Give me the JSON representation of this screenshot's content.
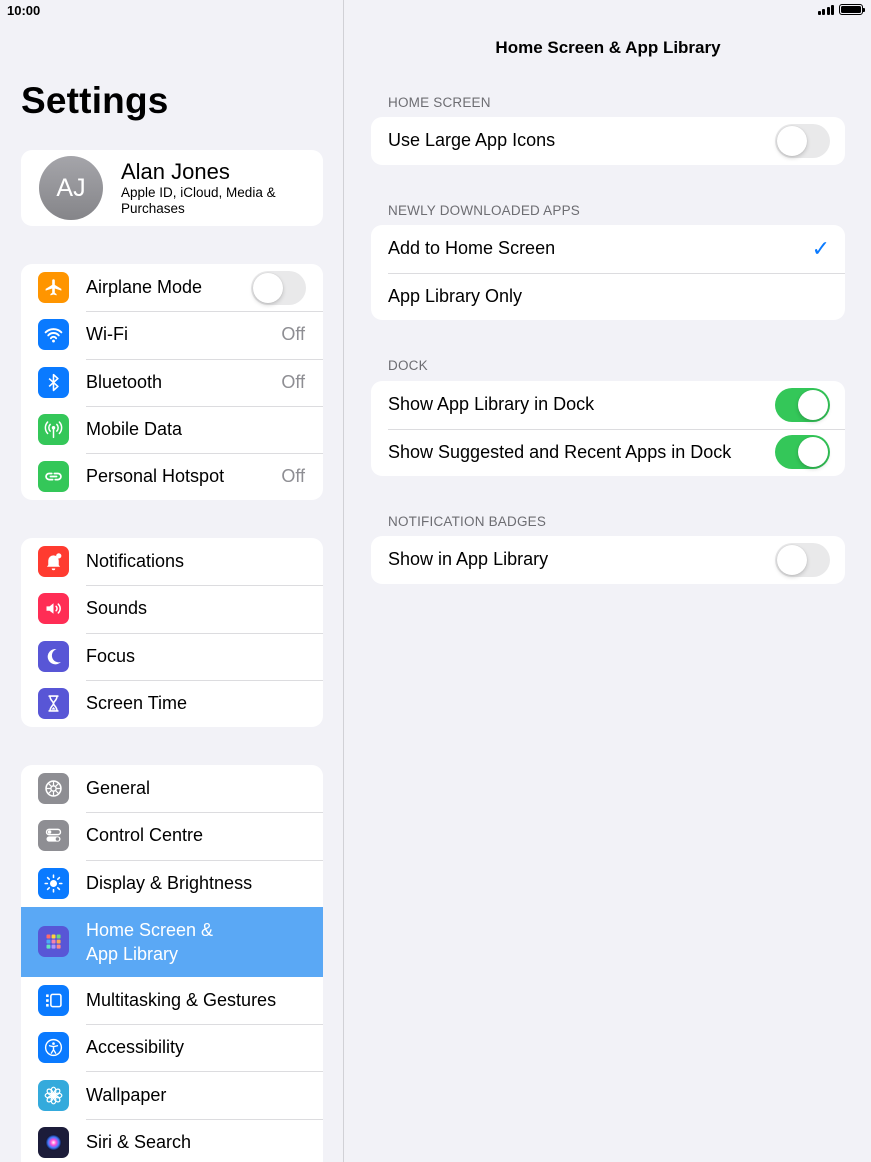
{
  "status": {
    "time": "10:00"
  },
  "sidebar": {
    "title": "Settings",
    "profile": {
      "initials": "AJ",
      "name": "Alan Jones",
      "subtitle": "Apple ID, iCloud, Media & Purchases"
    },
    "group1": [
      {
        "label": "Airplane Mode",
        "icon": "airplane-icon",
        "color": "#ff9500",
        "toggle": false
      },
      {
        "label": "Wi-Fi",
        "icon": "wifi-icon",
        "color": "#0a7aff",
        "value": "Off"
      },
      {
        "label": "Bluetooth",
        "icon": "bluetooth-icon",
        "color": "#0a7aff",
        "value": "Off"
      },
      {
        "label": "Mobile Data",
        "icon": "antenna-icon",
        "color": "#34c759"
      },
      {
        "label": "Personal Hotspot",
        "icon": "hotspot-icon",
        "color": "#34c759",
        "value": "Off"
      }
    ],
    "group2": [
      {
        "label": "Notifications",
        "icon": "bell-icon",
        "color": "#ff3b30"
      },
      {
        "label": "Sounds",
        "icon": "speaker-icon",
        "color": "#ff2d55"
      },
      {
        "label": "Focus",
        "icon": "moon-icon",
        "color": "#5856d6"
      },
      {
        "label": "Screen Time",
        "icon": "hourglass-icon",
        "color": "#5856d6"
      }
    ],
    "group3": [
      {
        "label": "General",
        "icon": "gear-icon",
        "color": "#8e8e93"
      },
      {
        "label": "Control Centre",
        "icon": "switches-icon",
        "color": "#8e8e93"
      },
      {
        "label": "Display & Brightness",
        "icon": "sun-icon",
        "color": "#0a7aff"
      },
      {
        "label": "Home Screen &\nApp Library",
        "icon": "app-grid-icon",
        "color": "#5856d6",
        "selected": true
      },
      {
        "label": "Multitasking & Gestures",
        "icon": "multitasking-icon",
        "color": "#0a7aff"
      },
      {
        "label": "Accessibility",
        "icon": "accessibility-icon",
        "color": "#0a7aff"
      },
      {
        "label": "Wallpaper",
        "icon": "flower-icon",
        "color": "#34aadc"
      },
      {
        "label": "Siri & Search",
        "icon": "siri-icon",
        "color": "#1c1c3a"
      }
    ]
  },
  "detail": {
    "title": "Home Screen & App Library",
    "sections": [
      {
        "header": "HOME SCREEN",
        "rows": [
          {
            "label": "Use Large App Icons",
            "toggle": false
          }
        ]
      },
      {
        "header": "NEWLY DOWNLOADED APPS",
        "rows": [
          {
            "label": "Add to Home Screen",
            "checked": true
          },
          {
            "label": "App Library Only"
          }
        ]
      },
      {
        "header": "DOCK",
        "rows": [
          {
            "label": "Show App Library in Dock",
            "toggle": true
          },
          {
            "label": "Show Suggested and Recent Apps in Dock",
            "toggle": true
          }
        ]
      },
      {
        "header": "NOTIFICATION BADGES",
        "rows": [
          {
            "label": "Show in App Library",
            "toggle": false
          }
        ]
      }
    ]
  }
}
